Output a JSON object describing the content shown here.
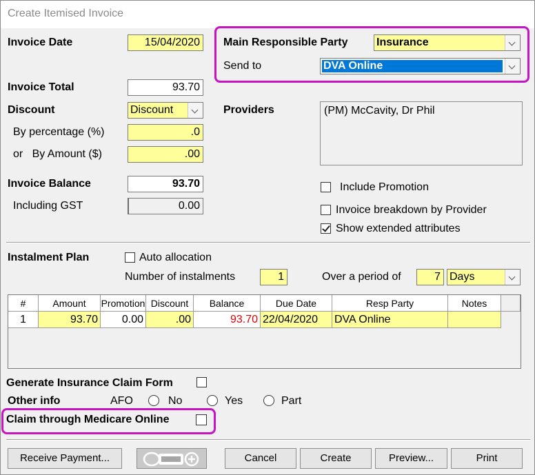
{
  "window": {
    "title": "Create Itemised Invoice"
  },
  "invoice": {
    "date_label": "Invoice Date",
    "date_value": "15/04/2020",
    "total_label": "Invoice Total",
    "total_value": "93.70",
    "discount_label": "Discount",
    "discount_value": "Discount",
    "by_pct_label": "By percentage (%)",
    "by_pct_value": ".0",
    "by_amount_label": "or   By Amount ($)",
    "by_amount_value": ".00",
    "balance_label": "Invoice Balance",
    "balance_value": "93.70",
    "gst_label": "Including GST",
    "gst_value": "0.00"
  },
  "party": {
    "main_label": "Main Responsible Party",
    "main_value": "Insurance",
    "send_label": "Send to",
    "send_value": "DVA Online",
    "providers_label": "Providers",
    "providers_value": "(PM) McCavity, Dr Phil"
  },
  "options": {
    "include_promotion": "Include Promotion",
    "breakdown": "Invoice breakdown by Provider",
    "extended": "Show extended attributes"
  },
  "instalment": {
    "plan_label": "Instalment Plan",
    "auto_label": "Auto allocation",
    "num_label": "Number of instalments",
    "num_value": "1",
    "period_label": "Over a period of",
    "period_value": "7",
    "period_unit": "Days"
  },
  "table": {
    "headers": [
      "#",
      "Amount",
      "Promotion",
      "Discount",
      "Balance",
      "Due Date",
      "Resp Party",
      "Notes"
    ],
    "row": [
      "1",
      "93.70",
      "0.00",
      ".00",
      "93.70",
      "22/04/2020",
      "DVA Online",
      ""
    ]
  },
  "claims": {
    "gen_form": "Generate Insurance Claim Form",
    "other_info": "Other info",
    "afo": "AFO",
    "no": "No",
    "yes": "Yes",
    "part": "Part",
    "medicare": "Claim through Medicare Online"
  },
  "buttons": {
    "receive": "Receive  Payment...",
    "cancel": "Cancel",
    "create": "Create",
    "preview": "Preview...",
    "print": "Print"
  },
  "colors": {
    "highlight": "#c513c5",
    "field_yellow": "#ffff99",
    "selected_blue": "#0078d7",
    "balance_red": "#e00000"
  }
}
